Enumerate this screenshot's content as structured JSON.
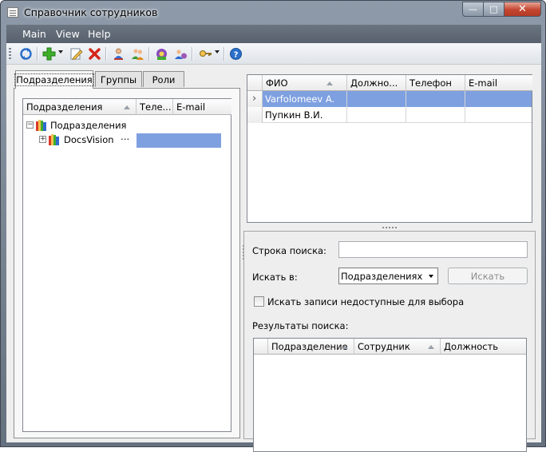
{
  "window": {
    "title": "Справочник сотрудников",
    "controls": {
      "minimize": "—",
      "maximize": "□",
      "close": "✕"
    }
  },
  "menu": {
    "items": [
      "Main",
      "View",
      "Help"
    ]
  },
  "toolbar": {
    "icons": [
      "refresh-icon",
      "add-icon",
      "edit-icon",
      "delete-icon",
      "user-icon",
      "users-icon",
      "group-icon",
      "role-icon",
      "key-icon",
      "help-icon"
    ]
  },
  "left": {
    "tabs": [
      "Подразделения",
      "Группы",
      "Роли"
    ],
    "columns": [
      "Подразделения",
      "Теле...",
      "E-mail"
    ],
    "tree": {
      "root": {
        "expander": "−",
        "label": "Подразделения"
      },
      "child": {
        "expander": "+",
        "label": "DocsVision",
        "ellipsis": "⋯"
      }
    }
  },
  "employees": {
    "columns": [
      "ФИО",
      "Должно...",
      "Телефон",
      "E-mail"
    ],
    "rows": [
      {
        "name": "Varfolomeev A.",
        "position": "",
        "phone": "",
        "email": "",
        "selected": true,
        "indicator": "›"
      },
      {
        "name": "Пупкин В.И.",
        "position": "",
        "phone": "",
        "email": "",
        "selected": false,
        "indicator": ""
      }
    ]
  },
  "search": {
    "query_label": "Строка поиска:",
    "query_value": "",
    "scope_label": "Искать в:",
    "scope_value": "Подразделениях",
    "search_button": "Искать",
    "include_unavailable_label": "Искать записи недоступные для выбора",
    "include_unavailable_checked": false,
    "results_label": "Результаты поиска:",
    "results_columns": [
      "Подразделение",
      "Сотрудник",
      "Должность"
    ]
  },
  "colors": {
    "selection": "#7ea0e0",
    "menubar": "#5f6975",
    "close_button": "#c4452f"
  }
}
